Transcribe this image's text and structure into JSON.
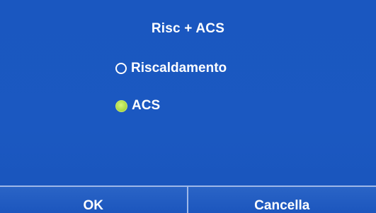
{
  "screen": {
    "title": "Risc + ACS",
    "options": [
      {
        "label": "Riscaldamento",
        "selected": false
      },
      {
        "label": "ACS",
        "selected": true
      }
    ]
  },
  "buttons": {
    "ok_label": "OK",
    "cancel_label": "Cancella"
  },
  "colors": {
    "background": "#1b58c1",
    "text": "#ffffff",
    "selected_radio": "#b6e04f",
    "divider": "#9fb8e8"
  },
  "icons": {
    "unselected_radio": "radio-unchecked-icon",
    "selected_radio": "radio-checked-icon"
  }
}
